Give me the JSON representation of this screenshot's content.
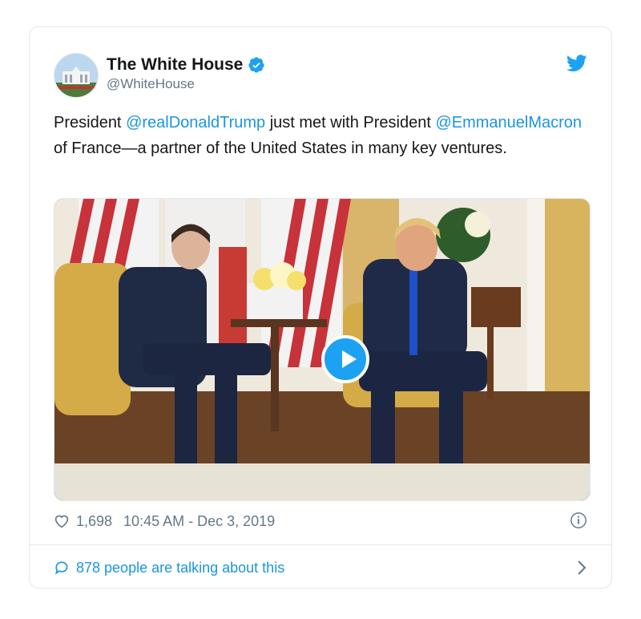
{
  "account": {
    "name": "The White House",
    "handle": "@WhiteHouse"
  },
  "tweet": {
    "text_before_1": "President ",
    "mention_1": "@realDonaldTrump",
    "text_after_1": " just met with President ",
    "mention_2": "@EmmanuelMacron",
    "text_after_2": " of France—a partner of the United States in many key ventures."
  },
  "stats": {
    "likes": "1,698",
    "timestamp": "10:45 AM - Dec 3, 2019"
  },
  "conversation": {
    "label": "878 people are talking about this"
  },
  "icons": {
    "verified": "verified-badge-icon",
    "bird": "twitter-bird-icon",
    "like": "heart-icon",
    "info": "info-icon",
    "reply": "speech-bubble-icon",
    "chevron": "chevron-right-icon",
    "play": "play-icon"
  },
  "colors": {
    "accent": "#1da1f2",
    "link": "#1b95e0",
    "muted": "#657786",
    "border": "#e1e8ed"
  }
}
